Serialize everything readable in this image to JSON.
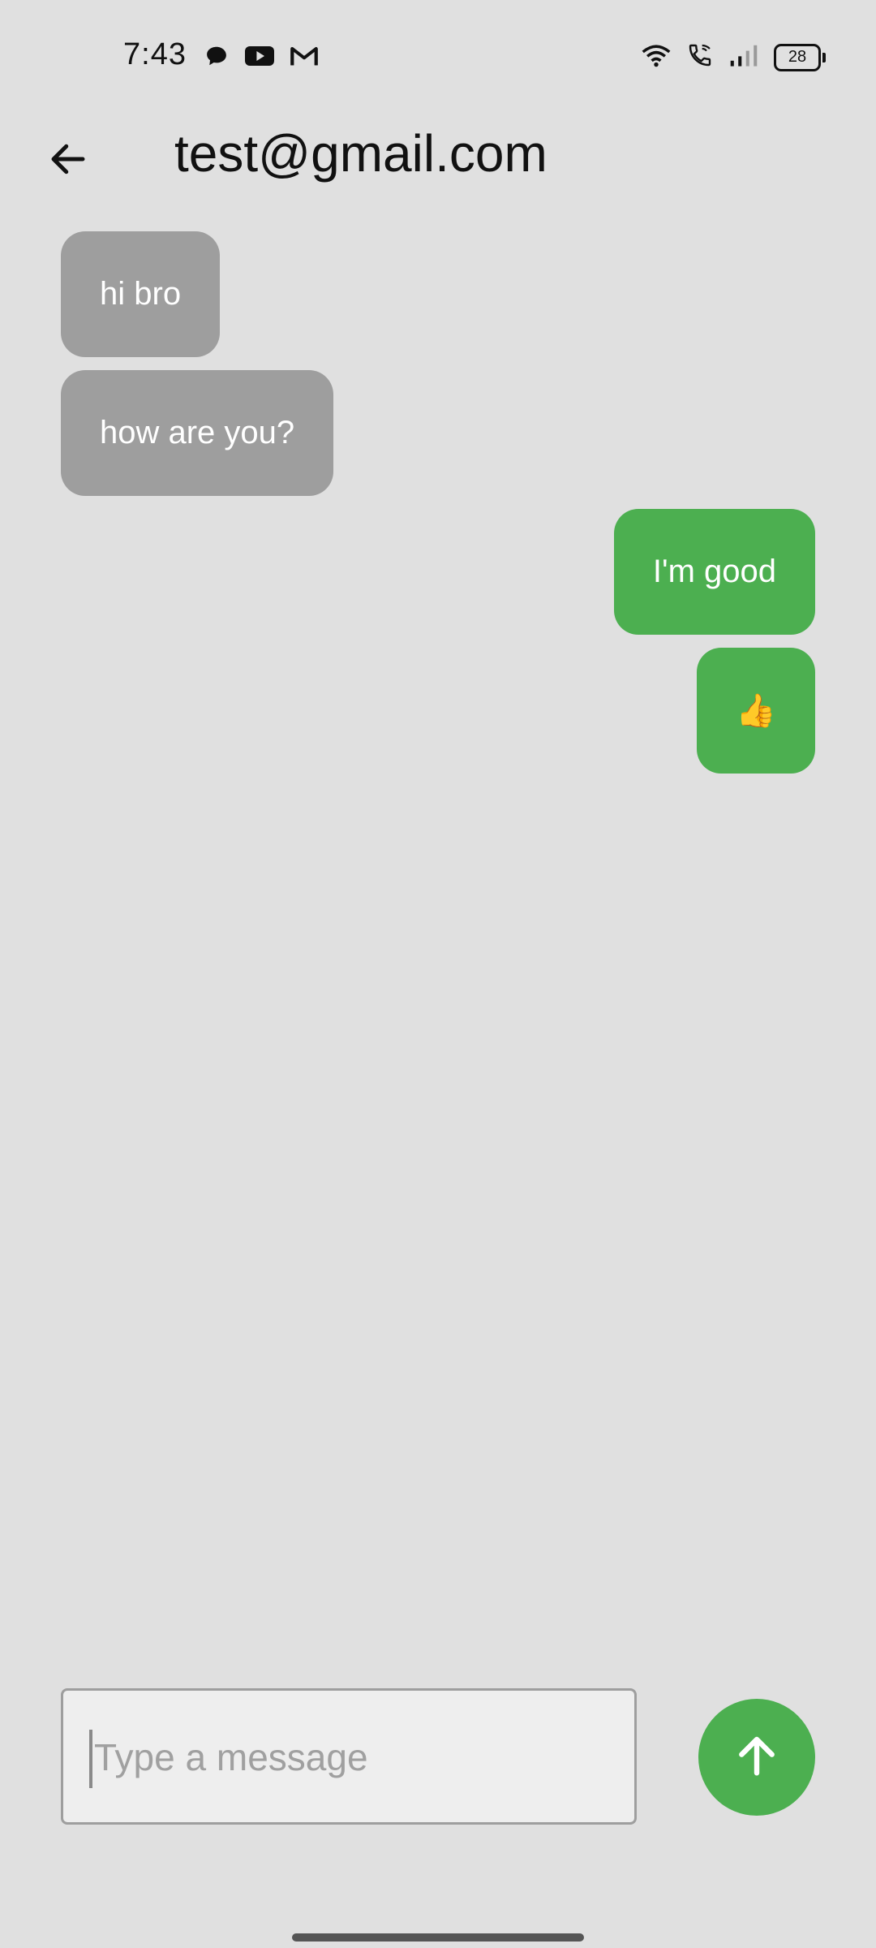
{
  "status_bar": {
    "time": "7:43",
    "battery_level": "28",
    "icons_left": [
      "chat-icon",
      "youtube-icon",
      "gmail-icon"
    ],
    "icons_right": [
      "wifi-icon",
      "wifi-calling-icon",
      "signal-icon",
      "battery-icon"
    ]
  },
  "app_bar": {
    "title": "test@gmail.com",
    "back_icon": "arrow-left-icon"
  },
  "messages": [
    {
      "direction": "incoming",
      "text": "hi bro"
    },
    {
      "direction": "incoming",
      "text": "how are you?"
    },
    {
      "direction": "outgoing",
      "text": "I'm good"
    },
    {
      "direction": "outgoing",
      "text": "👍"
    }
  ],
  "composer": {
    "placeholder": "Type a message",
    "value": "",
    "send_icon": "arrow-up-icon"
  },
  "colors": {
    "background": "#e0e0e0",
    "incoming_bubble": "#9e9e9e",
    "outgoing_bubble": "#4caf50",
    "send_button": "#4caf50"
  }
}
